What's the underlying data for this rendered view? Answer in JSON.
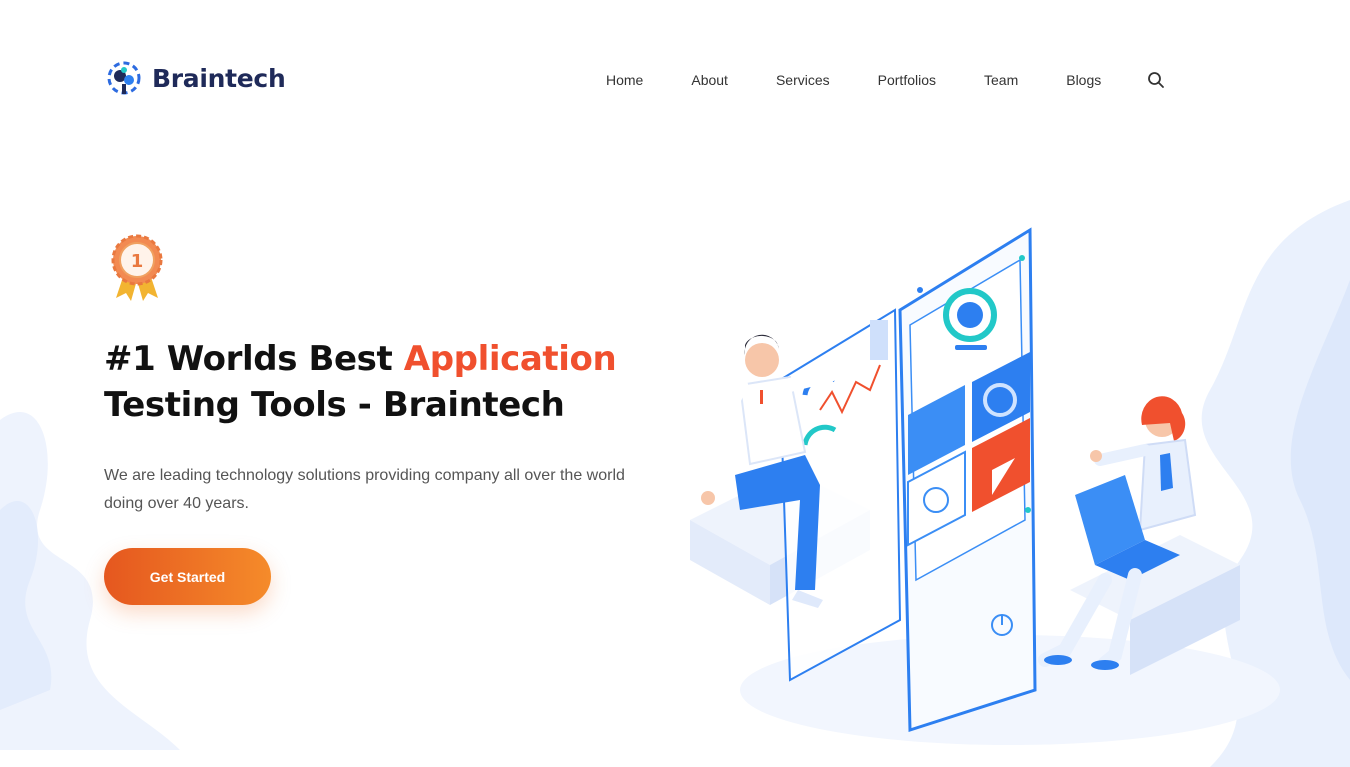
{
  "brand": {
    "name": "Braintech",
    "color": "#1f2a59",
    "accent": "#f0502e"
  },
  "nav": {
    "items": [
      "Home",
      "About",
      "Services",
      "Portfolios",
      "Team",
      "Blogs"
    ],
    "search_icon": "search-icon"
  },
  "hero": {
    "title_part1": "#1 Worlds Best ",
    "title_accent": "Application",
    "title_part2": "Testing Tools - Braintech",
    "description": "We are leading technology solutions providing company all over the world doing over 40 years.",
    "cta_label": "Get Started",
    "badge_icon": "medal-icon",
    "badge_number": "1"
  },
  "illustration": {
    "icon": "app-testing-illustration",
    "colors": {
      "primary": "#2d7ff0",
      "accent": "#f0502e",
      "teal": "#22c8c8"
    }
  }
}
